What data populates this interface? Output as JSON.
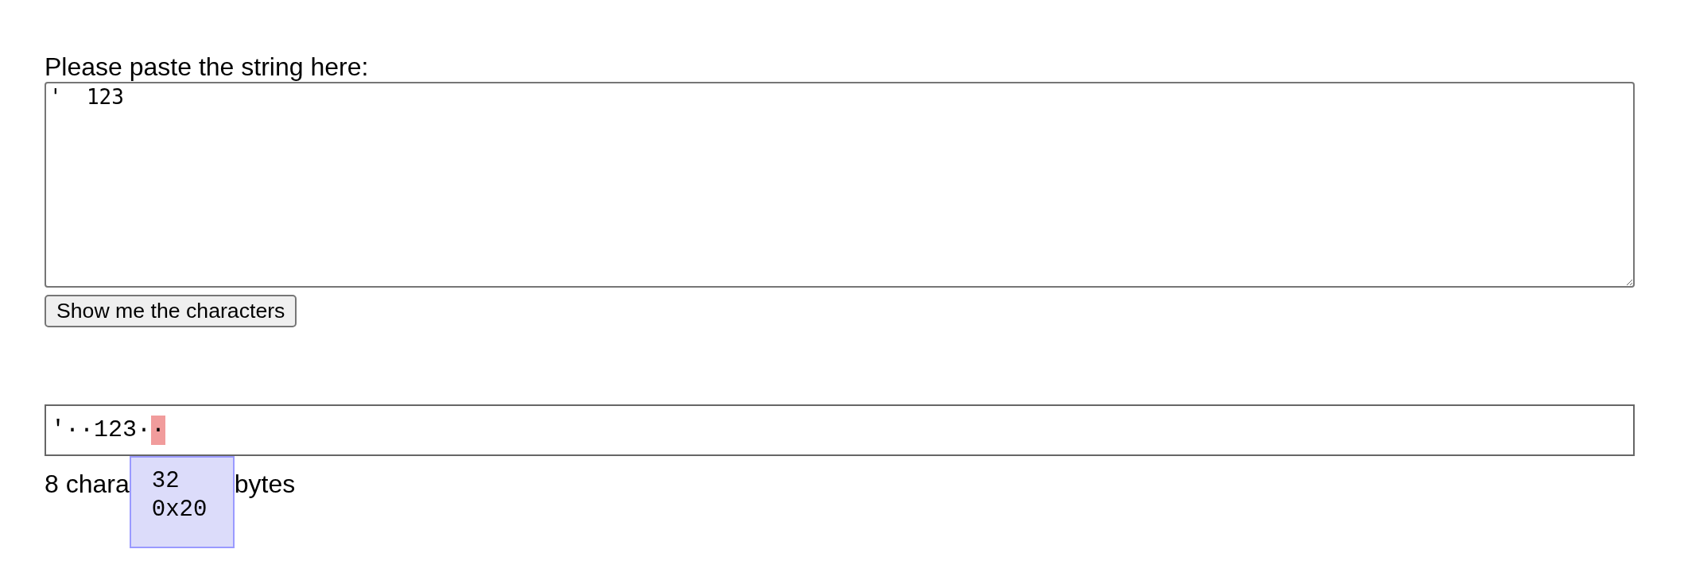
{
  "input": {
    "label": "Please paste the string here:",
    "value": "'  123"
  },
  "button": {
    "label": "Show me the characters"
  },
  "output": {
    "characters": [
      {
        "glyph": "'",
        "selected": false
      },
      {
        "glyph": "·",
        "selected": false
      },
      {
        "glyph": "·",
        "selected": false
      },
      {
        "glyph": "1",
        "selected": false
      },
      {
        "glyph": "2",
        "selected": false
      },
      {
        "glyph": "3",
        "selected": false
      },
      {
        "glyph": "·",
        "selected": false
      },
      {
        "glyph": "·",
        "selected": true
      }
    ],
    "tooltip": {
      "lines": [
        "32",
        "0x20"
      ]
    },
    "summary": [
      "8 chara",
      "bytes"
    ]
  }
}
